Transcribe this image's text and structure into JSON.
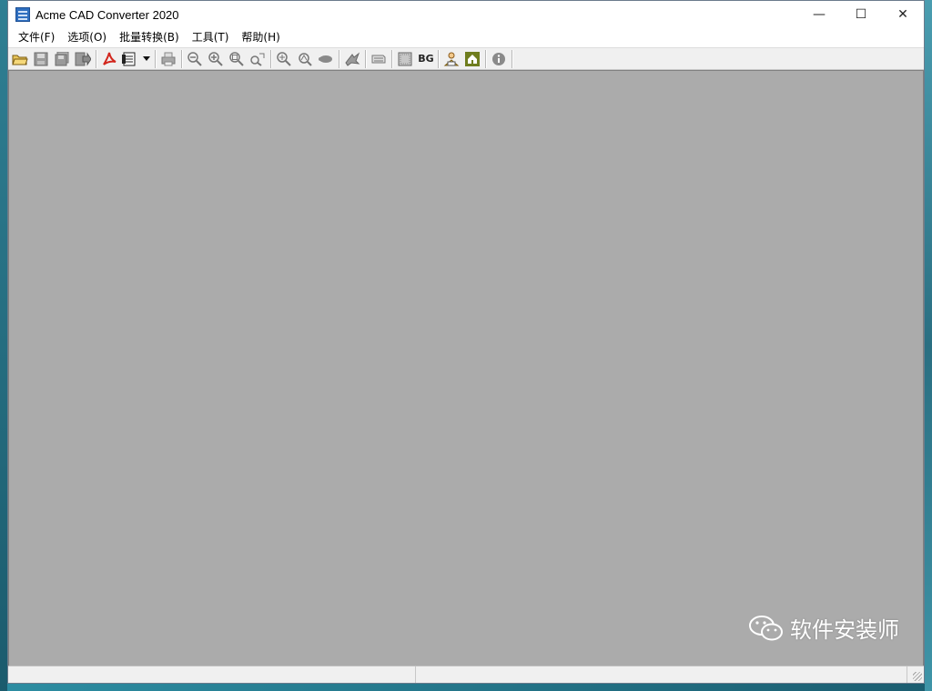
{
  "window": {
    "title": "Acme CAD Converter 2020",
    "minimize": "—",
    "maximize": "☐",
    "close": "✕"
  },
  "menu": [
    {
      "label": "文件(F)"
    },
    {
      "label": "选项(O)"
    },
    {
      "label": "批量转换(B)"
    },
    {
      "label": "工具(T)"
    },
    {
      "label": "帮助(H)"
    }
  ],
  "toolbar": {
    "bg_label": "BG",
    "icons": [
      "open-folder-icon",
      "save-icon",
      "save-all-icon",
      "export-icon",
      "pdf-icon",
      "print-setup-icon",
      "dropdown-arrow-icon",
      "print-icon",
      "zoom-out-icon",
      "zoom-in-icon",
      "zoom-window-icon",
      "zoom-dynamic-icon",
      "zoom-extents-icon",
      "zoom-realtime-icon",
      "pan-icon",
      "layers-icon",
      "layout-icon",
      "background-icon",
      "bg-text",
      "user-manual-icon",
      "home-icon",
      "info-icon"
    ]
  },
  "watermark": {
    "text": "软件安装师"
  },
  "status": {
    "pane1": "",
    "pane2": ""
  }
}
